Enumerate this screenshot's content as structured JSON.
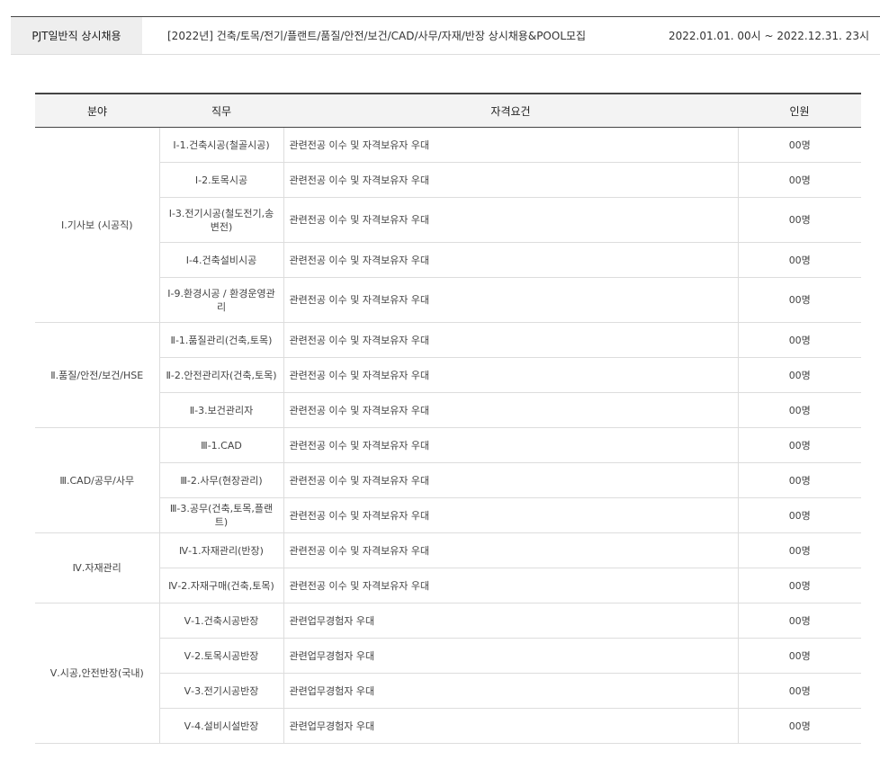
{
  "posting": {
    "type": "PJT일반직 상시채용",
    "title": "[2022년] 건축/토목/전기/플랜트/품질/안전/보건/CAD/사무/자재/반장 상시채용&POOL모집",
    "period": "2022.01.01. 00시 ~ 2022.12.31. 23시"
  },
  "table": {
    "headers": [
      "분야",
      "직무",
      "자격요건",
      "인원"
    ],
    "groups": [
      {
        "category": "Ⅰ.기사보 (시공직)",
        "rows": [
          {
            "role": "Ⅰ-1.건축시공(철골시공)",
            "req": "관련전공 이수 및 자격보유자 우대",
            "count": "00명"
          },
          {
            "role": "Ⅰ-2.토목시공",
            "req": "관련전공 이수 및 자격보유자 우대",
            "count": "00명"
          },
          {
            "role": "Ⅰ-3.전기시공(철도전기,송변전)",
            "req": "관련전공 이수 및 자격보유자 우대",
            "count": "00명"
          },
          {
            "role": "Ⅰ-4.건축설비시공",
            "req": "관련전공 이수 및 자격보유자 우대",
            "count": "00명"
          },
          {
            "role": "Ⅰ-9.환경시공 / 환경운영관리",
            "req": "관련전공 이수 및 자격보유자 우대",
            "count": "00명"
          }
        ]
      },
      {
        "category": "Ⅱ.품질/안전/보건/HSE",
        "rows": [
          {
            "role": "Ⅱ-1.품질관리(건축,토목)",
            "req": "관련전공 이수 및 자격보유자 우대",
            "count": "00명"
          },
          {
            "role": "Ⅱ-2.안전관리자(건축,토목)",
            "req": "관련전공 이수 및 자격보유자 우대",
            "count": "00명"
          },
          {
            "role": "Ⅱ-3.보건관리자",
            "req": "관련전공 이수 및 자격보유자 우대",
            "count": "00명"
          }
        ]
      },
      {
        "category": "Ⅲ.CAD/공무/사무",
        "rows": [
          {
            "role": "Ⅲ-1.CAD",
            "req": "관련전공 이수 및 자격보유자 우대",
            "count": "00명"
          },
          {
            "role": "Ⅲ-2.사무(현장관리)",
            "req": "관련전공 이수 및 자격보유자 우대",
            "count": "00명"
          },
          {
            "role": "Ⅲ-3.공무(건축,토목,플랜트)",
            "req": "관련전공 이수 및 자격보유자 우대",
            "count": "00명"
          }
        ]
      },
      {
        "category": "Ⅳ.자재관리",
        "rows": [
          {
            "role": "Ⅳ-1.자재관리(반장)",
            "req": "관련전공 이수 및 자격보유자 우대",
            "count": "00명"
          },
          {
            "role": "Ⅳ-2.자재구매(건축,토목)",
            "req": "관련전공 이수 및 자격보유자 우대",
            "count": "00명"
          }
        ]
      },
      {
        "category": "Ⅴ.시공,안전반장(국내)",
        "rows": [
          {
            "role": "Ⅴ-1.건축시공반장",
            "req": "관련업무경험자 우대",
            "count": "00명"
          },
          {
            "role": "Ⅴ-2.토목시공반장",
            "req": "관련업무경험자 우대",
            "count": "00명"
          },
          {
            "role": "Ⅴ-3.전기시공반장",
            "req": "관련업무경험자 우대",
            "count": "00명"
          },
          {
            "role": "Ⅴ-4.설비시설반장",
            "req": "관련업무경험자 우대",
            "count": "00명"
          }
        ]
      }
    ]
  }
}
